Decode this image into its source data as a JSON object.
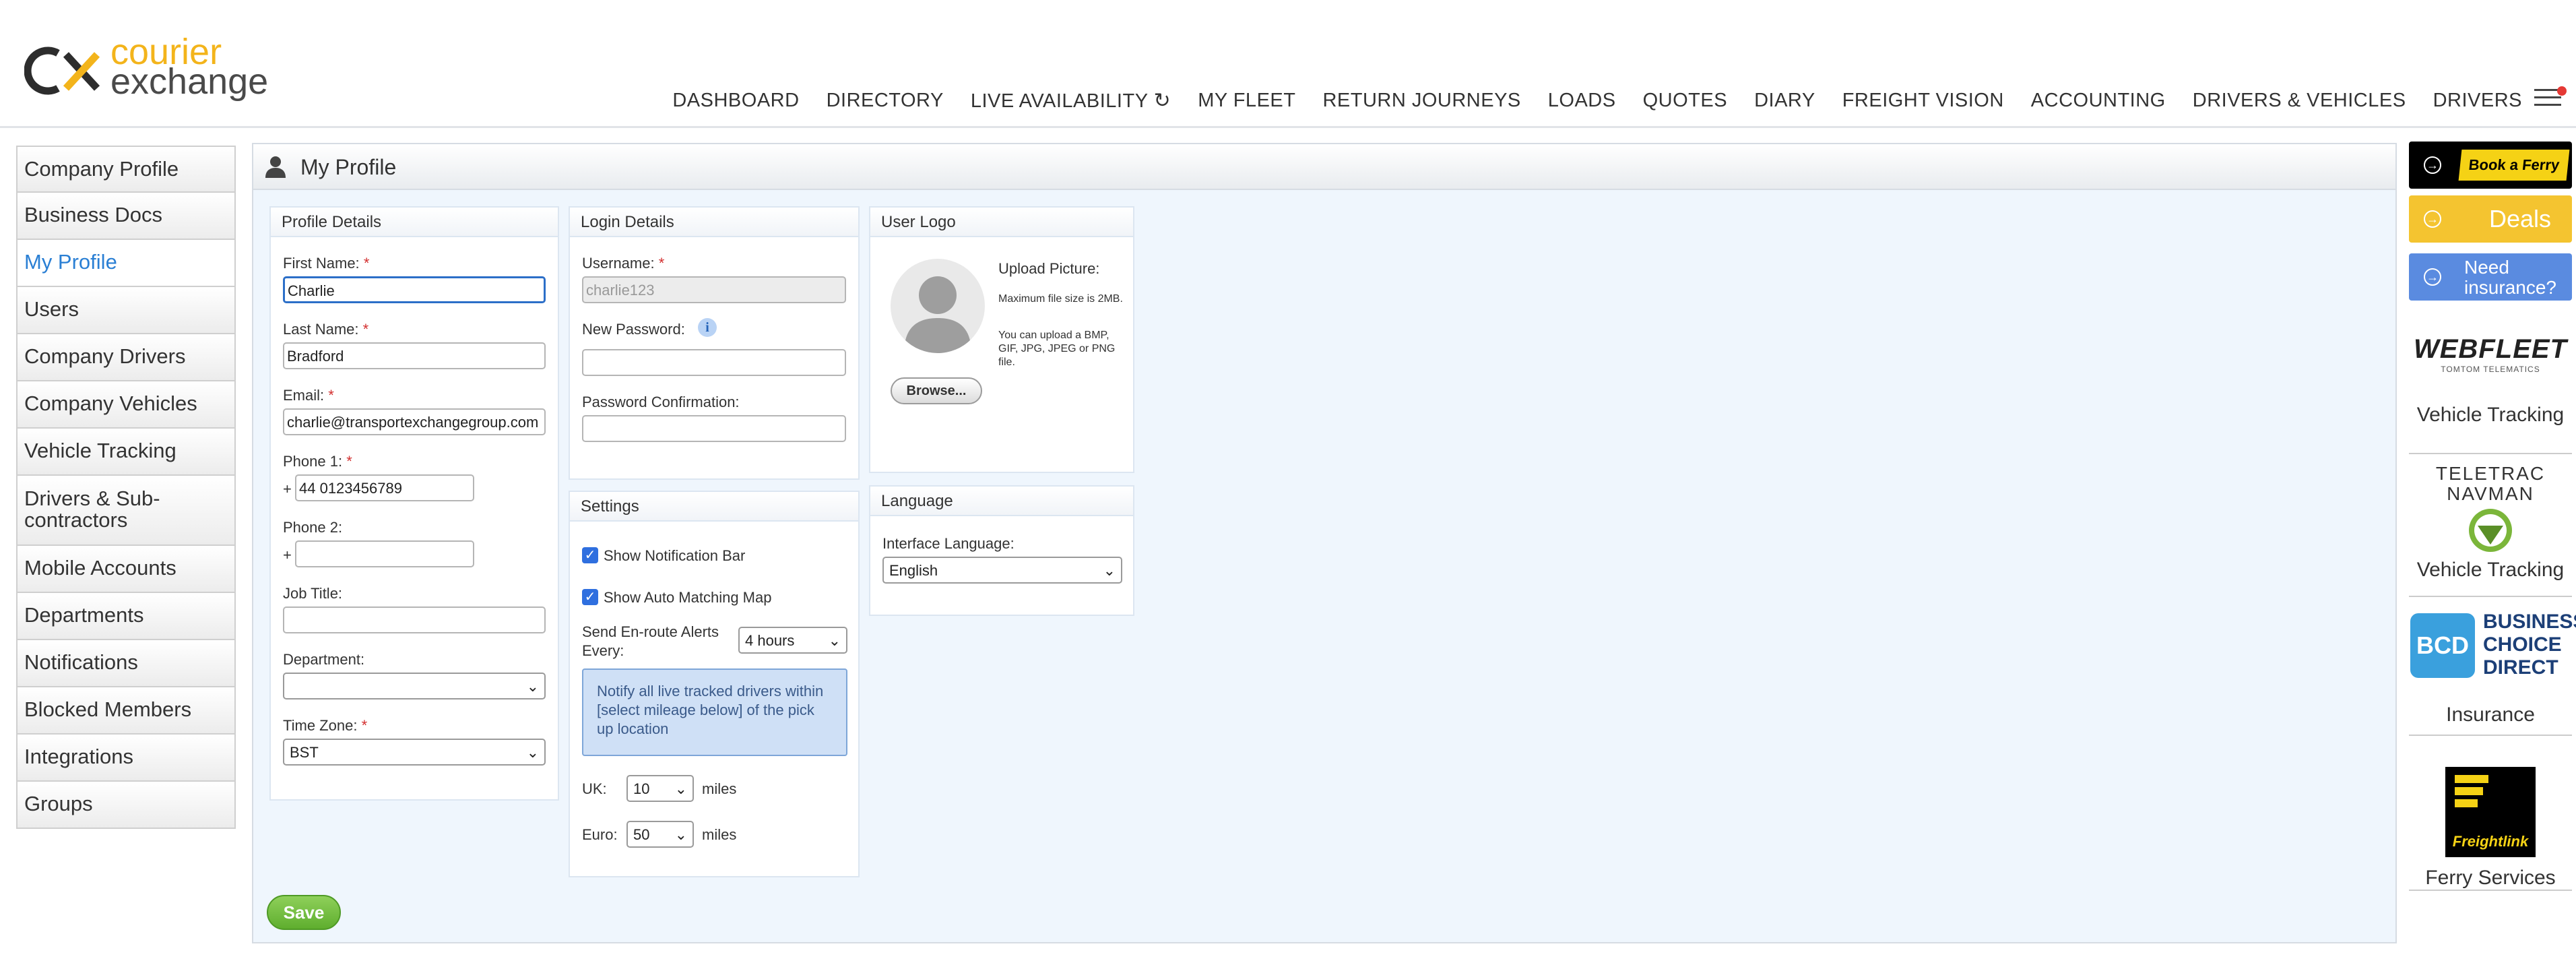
{
  "brand": {
    "cx": "CX",
    "line1": "courier",
    "line2": "exchange"
  },
  "nav": [
    "DASHBOARD",
    "DIRECTORY",
    "LIVE AVAILABILITY",
    "MY FLEET",
    "RETURN JOURNEYS",
    "LOADS",
    "QUOTES",
    "DIARY",
    "FREIGHT VISION",
    "ACCOUNTING",
    "DRIVERS & VEHICLES",
    "DRIVERS"
  ],
  "sidebar": [
    "Company Profile",
    "Business Docs",
    "My Profile",
    "Users",
    "Company Drivers",
    "Company Vehicles",
    "Vehicle Tracking",
    "Drivers & Sub-contractors",
    "Mobile Accounts",
    "Departments",
    "Notifications",
    "Blocked Members",
    "Integrations",
    "Groups"
  ],
  "page": {
    "title": "My Profile",
    "save": "Save"
  },
  "profile": {
    "title": "Profile Details",
    "first_name_label": "First Name:",
    "first_name": "Charlie",
    "last_name_label": "Last Name:",
    "last_name": "Bradford",
    "email_label": "Email:",
    "email": "charlie@transportexchangegroup.com",
    "phone1_label": "Phone 1:",
    "phone_prefix": "+",
    "phone1": "44 0123456789",
    "phone2_label": "Phone 2:",
    "phone2": "",
    "job_title_label": "Job Title:",
    "job_title": "",
    "department_label": "Department:",
    "department": "",
    "timezone_label": "Time Zone:",
    "timezone": "BST",
    "required_mark": "*"
  },
  "login": {
    "title": "Login Details",
    "username_label": "Username:",
    "username": "charlie123",
    "new_password_label": "New Password:",
    "password_confirm_label": "Password Confirmation:",
    "info": "i"
  },
  "settings": {
    "title": "Settings",
    "show_notification_bar": "Show Notification Bar",
    "show_auto_matching_map": "Show Auto Matching Map",
    "enroute_label": "Send En-route Alerts Every:",
    "enroute_value": "4 hours",
    "notify_text": "Notify all live tracked drivers within [select mileage below] of the pick up location",
    "uk_label": "UK:",
    "uk_value": "10",
    "euro_label": "Euro:",
    "euro_value": "50",
    "miles": "miles"
  },
  "logo_box": {
    "title": "User Logo",
    "upload_title": "Upload Picture:",
    "max_size": "Maximum file size is 2MB.",
    "formats": "You can upload a BMP, GIF, JPG, JPEG or PNG file.",
    "browse": "Browse..."
  },
  "language": {
    "title": "Language",
    "label": "Interface Language:",
    "value": "English"
  },
  "ads": {
    "ferry": "Book a Ferry",
    "deals": "Deals",
    "insurance": "Need insurance?",
    "webfleet": "WEBFLEET",
    "webfleet_sub": "TOMTOM TELEMATICS",
    "webfleet_caption": "Vehicle Tracking",
    "teletrac_line1": "TELETRAC",
    "teletrac_line2": "NAVMAN",
    "teletrac_caption": "Vehicle Tracking",
    "bcd": "BCD",
    "bcd_name": "BUSINESS CHOICE DIRECT",
    "bcd_caption": "Insurance",
    "freightlink": "Freightlink",
    "freightlink_caption": "Ferry Services"
  },
  "colors": {
    "accent": "#2a7fd4",
    "brand_yellow": "#f3b41b",
    "save_green": "#5fae2e"
  }
}
